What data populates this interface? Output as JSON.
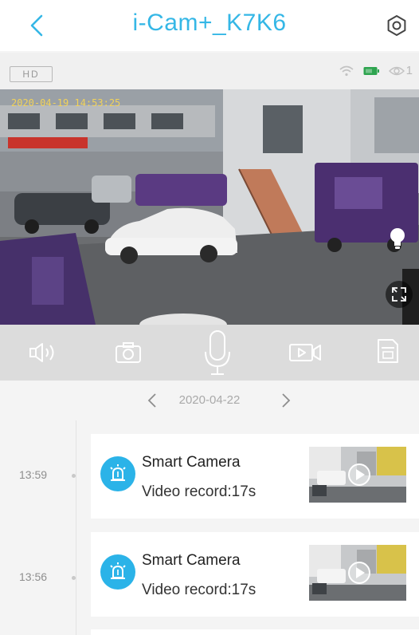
{
  "header": {
    "title": "i-Cam+_K7K6",
    "back_icon": "chevron-left-icon",
    "settings_icon": "gear-icon"
  },
  "video_status": {
    "quality_label": "HD",
    "viewer_count": "1",
    "wifi_icon": "wifi-icon",
    "battery_icon": "battery-icon",
    "viewers_icon": "eye-icon"
  },
  "video": {
    "timestamp": "2020-04-19 14:53:25",
    "light_icon": "lightbulb-icon",
    "fullscreen_icon": "fullscreen-icon"
  },
  "controls": [
    {
      "name": "speaker-button",
      "icon": "speaker-icon"
    },
    {
      "name": "snapshot-button",
      "icon": "camera-icon"
    },
    {
      "name": "talk-button",
      "icon": "microphone-icon"
    },
    {
      "name": "record-button",
      "icon": "video-record-icon"
    },
    {
      "name": "sd-card-button",
      "icon": "sd-card-icon"
    }
  ],
  "date_nav": {
    "date": "2020-04-22",
    "prev_icon": "chevron-left-icon",
    "next_icon": "chevron-right-icon"
  },
  "events": [
    {
      "time": "13:59",
      "title": "Smart Camera",
      "subtitle": "Video record:17s",
      "icon": "alarm-icon",
      "thumb_icon": "play-icon"
    },
    {
      "time": "13:56",
      "title": "Smart Camera",
      "subtitle": "Video record:17s",
      "icon": "alarm-icon",
      "thumb_icon": "play-icon"
    }
  ],
  "colors": {
    "accent": "#35b7e6",
    "alarm_icon_bg": "#2bb3e8"
  }
}
